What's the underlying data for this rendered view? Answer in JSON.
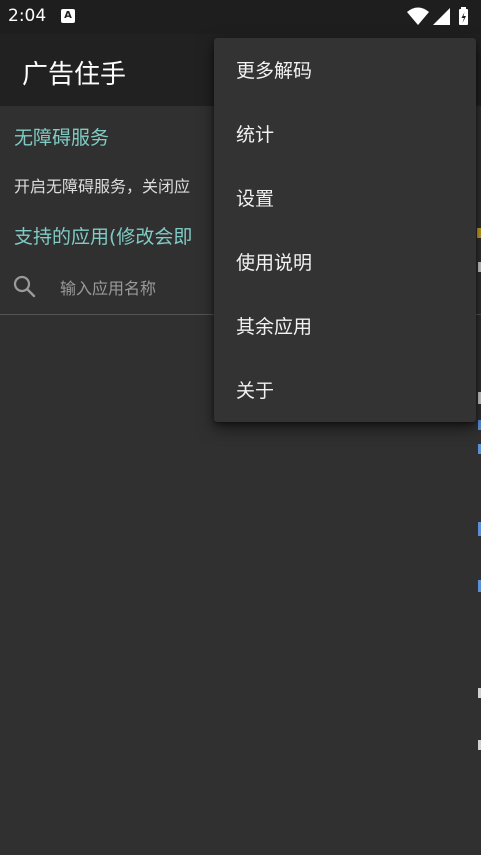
{
  "status_bar": {
    "time": "2:04",
    "app_icon_letter": "A"
  },
  "app_bar": {
    "title": "广告住手"
  },
  "content": {
    "accessibility_title": "无障碍服务",
    "accessibility_desc": "开启无障碍服务，关闭应",
    "supported_apps_title": "支持的应用(修改会即",
    "search_placeholder": "输入应用名称"
  },
  "menu": {
    "items": [
      "更多解码",
      "统计",
      "设置",
      "使用说明",
      "其余应用",
      "关于"
    ]
  },
  "colors": {
    "accent": "#80cbc4",
    "background": "#303030",
    "app_bar": "#212121",
    "menu": "#333333"
  }
}
